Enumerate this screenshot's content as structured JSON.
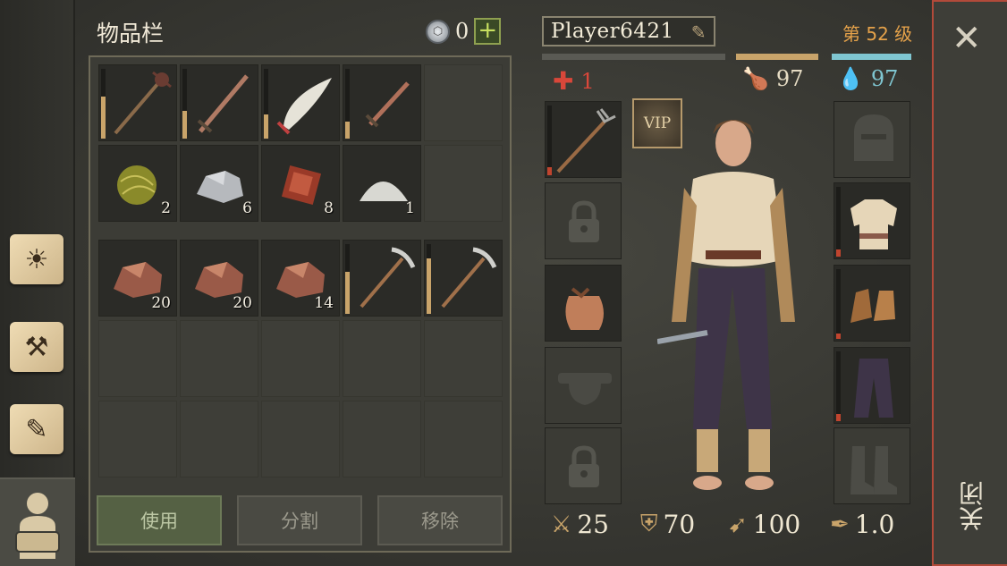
{
  "inventory": {
    "title": "物品栏",
    "currency_count": "0",
    "add_label": "+",
    "slots": [
      {
        "name": "mace-icon",
        "dur": 0.6
      },
      {
        "name": "sword-icon",
        "dur": 0.4
      },
      {
        "name": "scimitar-icon",
        "dur": 0.35
      },
      {
        "name": "dagger-icon",
        "dur": 0.25
      },
      {
        "name": "empty"
      },
      {
        "name": "fiber-ball-icon",
        "qty": "2"
      },
      {
        "name": "stone-icon",
        "qty": "6"
      },
      {
        "name": "raw-meat-bundle-icon",
        "qty": "8"
      },
      {
        "name": "salt-pile-icon",
        "qty": "1"
      },
      {
        "name": "empty"
      },
      {
        "name": "copper-ore-icon",
        "qty": "20"
      },
      {
        "name": "copper-ore-icon",
        "qty": "20"
      },
      {
        "name": "copper-ore-icon",
        "qty": "14"
      },
      {
        "name": "pickaxe-icon",
        "dur": 0.6
      },
      {
        "name": "pickaxe-icon",
        "dur": 0.8
      }
    ],
    "buttons": {
      "use": "使用",
      "split": "分割",
      "remove": "移除"
    }
  },
  "character": {
    "name": "Player6421",
    "level": "第 52 级",
    "health": "1",
    "food": "97",
    "water": "97",
    "vip": "VIP",
    "colors": {
      "health": "#d9473a",
      "food": "#c9a46a",
      "water": "#7fc6d1"
    },
    "bottom_stats": [
      {
        "icon": "attack-icon",
        "value": "25"
      },
      {
        "icon": "armor-icon",
        "value": "70"
      },
      {
        "icon": "speed-icon",
        "value": "100"
      },
      {
        "icon": "weight-icon",
        "value": "1.0"
      }
    ]
  },
  "close": {
    "label": "关闭"
  }
}
